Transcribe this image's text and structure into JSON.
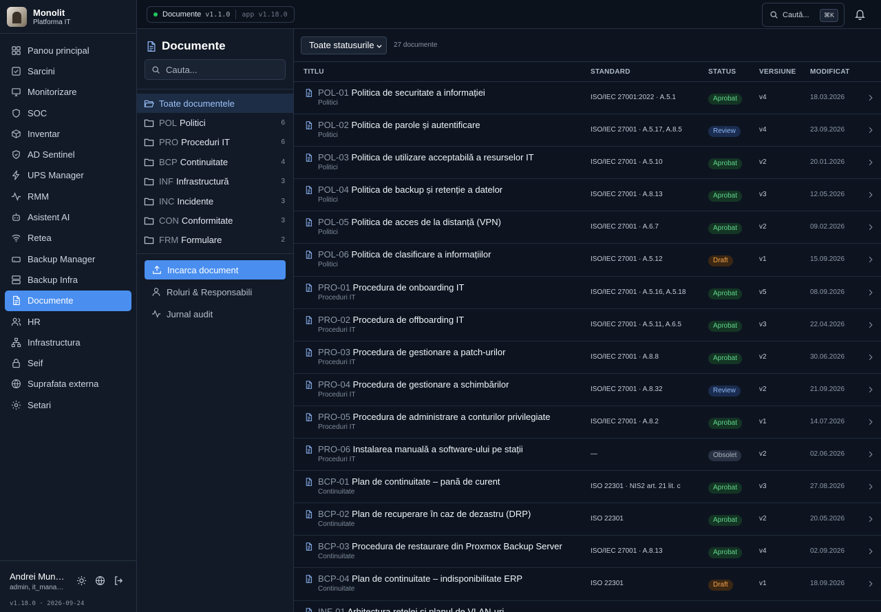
{
  "brand": {
    "title": "Monolit",
    "subtitle": "Platforma IT"
  },
  "nav": [
    {
      "label": "Panou principal",
      "icon": "grid-icon"
    },
    {
      "label": "Sarcini",
      "icon": "checkbox-icon"
    },
    {
      "label": "Monitorizare",
      "icon": "monitor-icon"
    },
    {
      "label": "SOC",
      "icon": "shield-icon"
    },
    {
      "label": "Inventar",
      "icon": "box-icon"
    },
    {
      "label": "AD Sentinel",
      "icon": "shield-check-icon"
    },
    {
      "label": "UPS Manager",
      "icon": "bolt-icon"
    },
    {
      "label": "RMM",
      "icon": "activity-icon"
    },
    {
      "label": "Asistent AI",
      "icon": "bot-icon"
    },
    {
      "label": "Retea",
      "icon": "wifi-icon"
    },
    {
      "label": "Backup Manager",
      "icon": "drive-icon"
    },
    {
      "label": "Backup Infra",
      "icon": "server-icon"
    },
    {
      "label": "Documente",
      "icon": "document-icon",
      "active": true
    },
    {
      "label": "HR",
      "icon": "users-icon"
    },
    {
      "label": "Infrastructura",
      "icon": "network-icon"
    },
    {
      "label": "Seif",
      "icon": "lock-icon"
    },
    {
      "label": "Suprafata externa",
      "icon": "globe-icon"
    },
    {
      "label": "Setari",
      "icon": "gear-icon"
    }
  ],
  "user": {
    "name": "Andrei Munt…",
    "role": "admin, it_mana…",
    "version": "v1.18.0 · 2026-09-24"
  },
  "topbar": {
    "module": "Documente",
    "module_version": "v1.1.0",
    "app_version": "app v1.18.0",
    "search_label": "Caută...",
    "shortcut": "⌘K"
  },
  "panel": {
    "title": "Documente",
    "search_placeholder": "Cauta...",
    "folders": [
      {
        "code": "",
        "label": "Toate documentele",
        "count": "",
        "active": true
      },
      {
        "code": "POL",
        "label": "Politici",
        "count": "6"
      },
      {
        "code": "PRO",
        "label": "Proceduri IT",
        "count": "6"
      },
      {
        "code": "BCP",
        "label": "Continuitate",
        "count": "4"
      },
      {
        "code": "INF",
        "label": "Infrastructură",
        "count": "3"
      },
      {
        "code": "INC",
        "label": "Incidente",
        "count": "3"
      },
      {
        "code": "CON",
        "label": "Conformitate",
        "count": "3"
      },
      {
        "code": "FRM",
        "label": "Formulare",
        "count": "2"
      }
    ],
    "upload_label": "Incarca document",
    "links": [
      {
        "label": "Roluri & Responsabili",
        "icon": "user-icon"
      },
      {
        "label": "Jurnal audit",
        "icon": "activity-icon"
      }
    ]
  },
  "toolbar": {
    "status_filter": "Toate statusurile",
    "doc_count": "27 documente"
  },
  "table": {
    "columns": {
      "title": "TITLU",
      "standard": "STANDARD",
      "status": "STATUS",
      "version": "VERSIUNE",
      "modified": "MODIFICAT"
    },
    "rows": [
      {
        "code": "POL-01",
        "title": "Politica de securitate a informației",
        "category": "Politici",
        "standard": "ISO/IEC 27001:2022 · A.5.1",
        "status": "Aprobat",
        "version": "v4",
        "modified": "18.03.2026"
      },
      {
        "code": "POL-02",
        "title": "Politica de parole și autentificare",
        "category": "Politici",
        "standard": "ISO/IEC 27001 · A.5.17, A.8.5",
        "status": "Review",
        "version": "v4",
        "modified": "23.09.2026"
      },
      {
        "code": "POL-03",
        "title": "Politica de utilizare acceptabilă a resurselor IT",
        "category": "Politici",
        "standard": "ISO/IEC 27001 · A.5.10",
        "status": "Aprobat",
        "version": "v2",
        "modified": "20.01.2026"
      },
      {
        "code": "POL-04",
        "title": "Politica de backup și retenție a datelor",
        "category": "Politici",
        "standard": "ISO/IEC 27001 · A.8.13",
        "status": "Aprobat",
        "version": "v3",
        "modified": "12.05.2026"
      },
      {
        "code": "POL-05",
        "title": "Politica de acces de la distanță (VPN)",
        "category": "Politici",
        "standard": "ISO/IEC 27001 · A.6.7",
        "status": "Aprobat",
        "version": "v2",
        "modified": "09.02.2026"
      },
      {
        "code": "POL-06",
        "title": "Politica de clasificare a informațiilor",
        "category": "Politici",
        "standard": "ISO/IEC 27001 · A.5.12",
        "status": "Draft",
        "version": "v1",
        "modified": "15.09.2026"
      },
      {
        "code": "PRO-01",
        "title": "Procedura de onboarding IT",
        "category": "Proceduri IT",
        "standard": "ISO/IEC 27001 · A.5.16, A.5.18",
        "status": "Aprobat",
        "version": "v5",
        "modified": "08.09.2026"
      },
      {
        "code": "PRO-02",
        "title": "Procedura de offboarding IT",
        "category": "Proceduri IT",
        "standard": "ISO/IEC 27001 · A.5.11, A.6.5",
        "status": "Aprobat",
        "version": "v3",
        "modified": "22.04.2026"
      },
      {
        "code": "PRO-03",
        "title": "Procedura de gestionare a patch-urilor",
        "category": "Proceduri IT",
        "standard": "ISO/IEC 27001 · A.8.8",
        "status": "Aprobat",
        "version": "v2",
        "modified": "30.06.2026"
      },
      {
        "code": "PRO-04",
        "title": "Procedura de gestionare a schimbărilor",
        "category": "Proceduri IT",
        "standard": "ISO/IEC 27001 · A.8.32",
        "status": "Review",
        "version": "v2",
        "modified": "21.09.2026"
      },
      {
        "code": "PRO-05",
        "title": "Procedura de administrare a conturilor privilegiate",
        "category": "Proceduri IT",
        "standard": "ISO/IEC 27001 · A.8.2",
        "status": "Aprobat",
        "version": "v1",
        "modified": "14.07.2026"
      },
      {
        "code": "PRO-06",
        "title": "Instalarea manuală a software-ului pe stații",
        "category": "Proceduri IT",
        "standard": "—",
        "status": "Obsolet",
        "version": "v2",
        "modified": "02.06.2026"
      },
      {
        "code": "BCP-01",
        "title": "Plan de continuitate – pană de curent",
        "category": "Continuitate",
        "standard": "ISO 22301 · NIS2 art. 21 lit. c",
        "status": "Aprobat",
        "version": "v3",
        "modified": "27.08.2026"
      },
      {
        "code": "BCP-02",
        "title": "Plan de recuperare în caz de dezastru (DRP)",
        "category": "Continuitate",
        "standard": "ISO 22301",
        "status": "Aprobat",
        "version": "v2",
        "modified": "20.05.2026"
      },
      {
        "code": "BCP-03",
        "title": "Procedura de restaurare din Proxmox Backup Server",
        "category": "Continuitate",
        "standard": "ISO/IEC 27001 · A.8.13",
        "status": "Aprobat",
        "version": "v4",
        "modified": "02.09.2026"
      },
      {
        "code": "BCP-04",
        "title": "Plan de continuitate – indisponibilitate ERP",
        "category": "Continuitate",
        "standard": "ISO 22301",
        "status": "Draft",
        "version": "v1",
        "modified": "18.09.2026"
      },
      {
        "code": "INF-01",
        "title": "Arhitectura rețelei și planul de VLAN-uri",
        "category": "",
        "standard": "",
        "status": "",
        "version": "",
        "modified": ""
      }
    ]
  }
}
